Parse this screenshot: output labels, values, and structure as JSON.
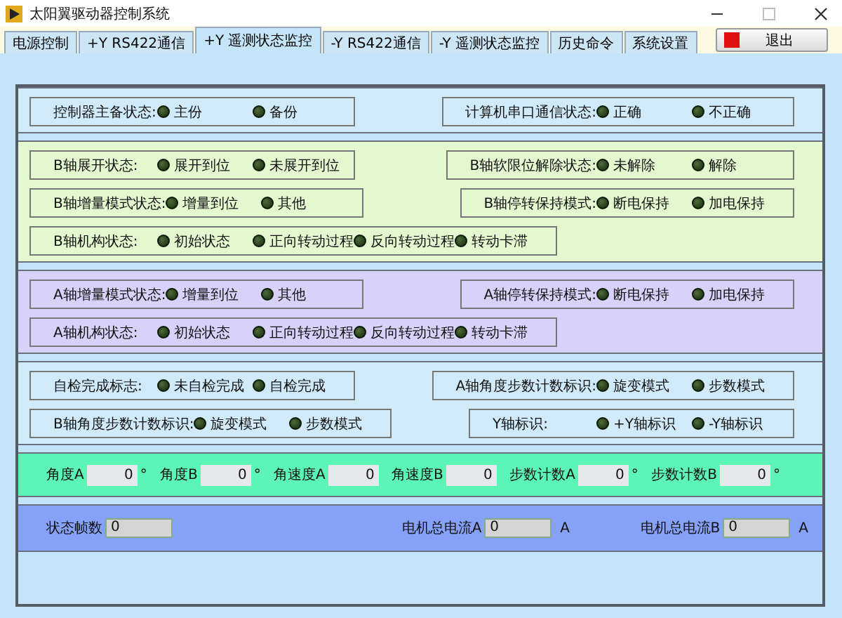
{
  "window": {
    "title": "太阳翼驱动器控制系统"
  },
  "tabs": [
    {
      "label": "电源控制",
      "selected": false
    },
    {
      "label": "+Y RS422通信",
      "selected": false
    },
    {
      "label": "+Y 遥测状态监控",
      "selected": true
    },
    {
      "label": "-Y RS422通信",
      "selected": false
    },
    {
      "label": "-Y 遥测状态监控",
      "selected": false
    },
    {
      "label": "历史命令",
      "selected": false
    },
    {
      "label": "系统设置",
      "selected": false
    }
  ],
  "exit_button": {
    "label": "退出"
  },
  "sections": [
    {
      "kind": "leds",
      "color": "#d0eafa",
      "rows": [
        {
          "left": {
            "label": "控制器主备状态:",
            "leds": [
              {
                "label": "主份",
                "on": false
              },
              {
                "label": "备份",
                "on": false
              }
            ]
          },
          "right": {
            "label": "计算机串口通信状态:",
            "leds": [
              {
                "label": "正确",
                "on": false
              },
              {
                "label": "不正确",
                "on": false
              }
            ]
          }
        }
      ]
    },
    {
      "kind": "leds",
      "color": "#e4f8d0",
      "rows": [
        {
          "left": {
            "label": "B轴展开状态:",
            "leds": [
              {
                "label": "展开到位",
                "on": false
              },
              {
                "label": "未展开到位",
                "on": false
              }
            ]
          },
          "right": {
            "label": "B轴软限位解除状态:",
            "leds": [
              {
                "label": "未解除",
                "on": false
              },
              {
                "label": "解除",
                "on": false
              }
            ]
          }
        },
        {
          "left": {
            "label": "B轴增量模式状态:",
            "leds": [
              {
                "label": "增量到位",
                "on": false
              },
              {
                "label": "其他",
                "on": false
              }
            ]
          },
          "right": {
            "label": "B轴停转保持模式:",
            "leds": [
              {
                "label": "断电保持",
                "on": false
              },
              {
                "label": "加电保持",
                "on": false
              }
            ]
          }
        },
        {
          "left": {
            "label": "B轴机构状态:",
            "leds": [
              {
                "label": "初始状态",
                "on": false
              },
              {
                "label": "正向转动过程",
                "on": false
              },
              {
                "label": "反向转动过程",
                "on": false
              },
              {
                "label": "转动卡滞",
                "on": false
              }
            ]
          }
        }
      ]
    },
    {
      "kind": "leds",
      "color": "#d8d2fa",
      "rows": [
        {
          "left": {
            "label": "A轴增量模式状态:",
            "leds": [
              {
                "label": "增量到位",
                "on": false
              },
              {
                "label": "其他",
                "on": false
              }
            ]
          },
          "right": {
            "label": "A轴停转保持模式:",
            "leds": [
              {
                "label": "断电保持",
                "on": false
              },
              {
                "label": "加电保持",
                "on": false
              }
            ]
          }
        },
        {
          "left": {
            "label": "A轴机构状态:",
            "leds": [
              {
                "label": "初始状态",
                "on": false
              },
              {
                "label": "正向转动过程",
                "on": false
              },
              {
                "label": "反向转动过程",
                "on": false
              },
              {
                "label": "转动卡滞",
                "on": false
              }
            ]
          }
        }
      ]
    },
    {
      "kind": "leds",
      "color": "#d0eafa",
      "rows": [
        {
          "left": {
            "label": "自检完成标志:",
            "leds": [
              {
                "label": "未自检完成",
                "on": false
              },
              {
                "label": "自检完成",
                "on": false
              }
            ]
          },
          "right": {
            "label": "A轴角度步数计数标识:",
            "leds": [
              {
                "label": "旋变模式",
                "on": false
              },
              {
                "label": "步数模式",
                "on": false
              }
            ]
          }
        },
        {
          "left": {
            "label": "B轴角度步数计数标识:",
            "leds": [
              {
                "label": "旋变模式",
                "on": false
              },
              {
                "label": "步数模式",
                "on": false
              }
            ]
          },
          "right": {
            "label": "Y轴标识:",
            "leds": [
              {
                "label": "+Y轴标识",
                "on": false
              },
              {
                "label": "-Y轴标识",
                "on": false
              }
            ]
          }
        }
      ]
    },
    {
      "kind": "readouts",
      "color": "#5cf5b6",
      "fields": [
        {
          "label": "角度A",
          "value": "0",
          "unit": "°"
        },
        {
          "label": "角度B",
          "value": "0",
          "unit": "°"
        },
        {
          "label": "角速度A",
          "value": "0"
        },
        {
          "label": "角速度B",
          "value": "0"
        },
        {
          "label": "步数计数A",
          "value": "0",
          "unit": "°"
        },
        {
          "label": "步数计数B",
          "value": "0",
          "unit": "°"
        }
      ]
    },
    {
      "kind": "currents",
      "color": "#86a2f8",
      "fields": [
        {
          "label": "状态帧数",
          "value": "0"
        },
        {
          "label": "电机总电流A",
          "value": "0",
          "unit": "A"
        },
        {
          "label": "电机总电流B",
          "value": "0",
          "unit": "A"
        }
      ]
    }
  ]
}
